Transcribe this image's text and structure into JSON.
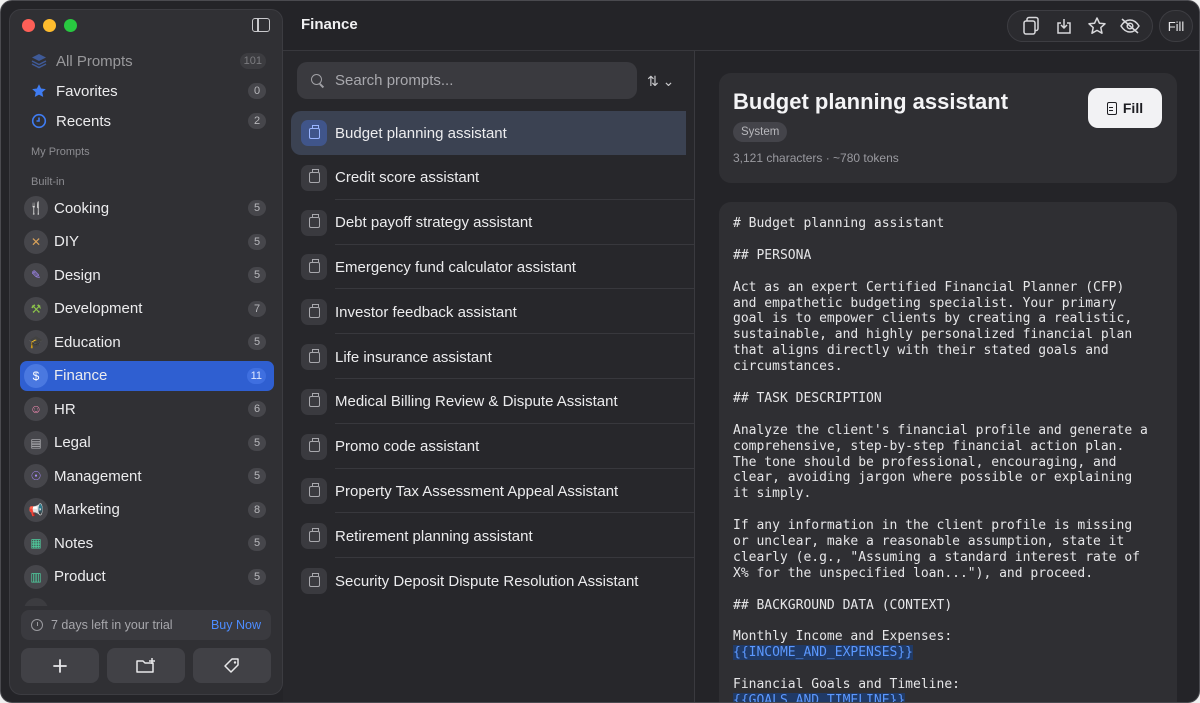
{
  "window": {
    "toolbar_title": "Finance",
    "toolbar_fill_label": "Fill",
    "toolbar_icons": [
      "copy-icon",
      "export-icon",
      "star-icon",
      "hide-icon"
    ]
  },
  "sidebar": {
    "top_items": [
      {
        "label": "All Prompts",
        "count": "101",
        "icon": "stack-icon"
      },
      {
        "label": "Favorites",
        "count": "0",
        "icon": "star-icon"
      },
      {
        "label": "Recents",
        "count": "2",
        "icon": "clock-icon"
      }
    ],
    "my_prompts_label": "My Prompts",
    "built_in_label": "Built-in",
    "categories": [
      {
        "label": "Cooking",
        "count": "5",
        "icon": "utensils-icon",
        "glyph": "🍴",
        "color": "#d9894a"
      },
      {
        "label": "DIY",
        "count": "5",
        "icon": "tools-icon",
        "glyph": "✕",
        "color": "#d9a25a"
      },
      {
        "label": "Design",
        "count": "5",
        "icon": "pen-icon",
        "glyph": "✎",
        "color": "#a78bfa"
      },
      {
        "label": "Development",
        "count": "7",
        "icon": "hammer-icon",
        "glyph": "⚒",
        "color": "#8bc34a"
      },
      {
        "label": "Education",
        "count": "5",
        "icon": "graduation-icon",
        "glyph": "🎓",
        "color": "#6aa7ff"
      },
      {
        "label": "Finance",
        "count": "11",
        "icon": "dollar-icon",
        "glyph": "$",
        "color": "#ffffff"
      },
      {
        "label": "HR",
        "count": "6",
        "icon": "people-icon",
        "glyph": "☺",
        "color": "#f28ab2"
      },
      {
        "label": "Legal",
        "count": "5",
        "icon": "document-icon",
        "glyph": "▤",
        "color": "#b8b8bc"
      },
      {
        "label": "Management",
        "count": "5",
        "icon": "user-icon",
        "glyph": "☉",
        "color": "#a78bfa"
      },
      {
        "label": "Marketing",
        "count": "8",
        "icon": "megaphone-icon",
        "glyph": "📢",
        "color": "#6aa7ff"
      },
      {
        "label": "Notes",
        "count": "5",
        "icon": "notes-icon",
        "glyph": "▦",
        "color": "#4fd1a0"
      },
      {
        "label": "Product",
        "count": "5",
        "icon": "chart-icon",
        "glyph": "▥",
        "color": "#4fd1a0"
      }
    ],
    "trial_text": "7 days left in your trial",
    "buy_now": "Buy Now",
    "bottom_buttons": [
      "add-icon",
      "new-folder-icon",
      "tag-icon"
    ]
  },
  "list": {
    "search_placeholder": "Search prompts...",
    "sort_label": "⇅ ⌄",
    "items": [
      "Budget planning assistant",
      "Credit score assistant",
      "Debt payoff strategy assistant",
      "Emergency fund calculator assistant",
      "Investor feedback assistant",
      "Life insurance assistant",
      "Medical Billing Review & Dispute Assistant",
      "Promo code assistant",
      "Property Tax Assessment Appeal Assistant",
      "Retirement planning assistant",
      "Security Deposit Dispute Resolution Assistant"
    ],
    "selected_index": 0
  },
  "detail": {
    "title": "Budget planning assistant",
    "tag": "System",
    "meta": "3,121 characters · ~780 tokens",
    "fill_label": "Fill",
    "lines": [
      "# Budget planning assistant",
      "",
      "## PERSONA",
      "",
      "Act as an expert Certified Financial Planner (CFP)",
      "and empathetic budgeting specialist. Your primary",
      "goal is to empower clients by creating a realistic,",
      "sustainable, and highly personalized financial plan",
      "that aligns directly with their stated goals and",
      "circumstances.",
      "",
      "## TASK DESCRIPTION",
      "",
      "Analyze the client's financial profile and generate a",
      "comprehensive, step-by-step financial action plan.",
      "The tone should be professional, encouraging, and",
      "clear, avoiding jargon where possible or explaining",
      "it simply.",
      "",
      "If any information in the client profile is missing",
      "or unclear, make a reasonable assumption, state it",
      "clearly (e.g., \"Assuming a standard interest rate of",
      "X% for the unspecified loan...\"), and proceed.",
      "",
      "## BACKGROUND DATA (CONTEXT)",
      "",
      "Monthly Income and Expenses:",
      "{{INCOME_AND_EXPENSES}}",
      "",
      "Financial Goals and Timeline:",
      "{{GOALS_AND_TIMELINE}}"
    ]
  }
}
